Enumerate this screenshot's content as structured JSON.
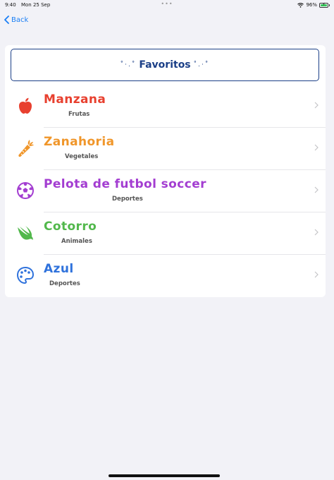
{
  "status_bar": {
    "time": "9:40",
    "date": "Mon 25 Sep",
    "battery": "96%"
  },
  "nav": {
    "back_label": "Back"
  },
  "header": {
    "title": "Favoritos",
    "decor_left": "˚·.˚",
    "decor_right": "˚.·˚"
  },
  "items": [
    {
      "title": "Manzana",
      "subtitle": "Frutas",
      "color": "#e8402f",
      "icon": "apple-icon"
    },
    {
      "title": "Zanahoria",
      "subtitle": "Vegetales",
      "color": "#f0962a",
      "icon": "carrot-icon"
    },
    {
      "title": "Pelota de futbol soccer",
      "subtitle": "Deportes",
      "color": "#a33dd1",
      "icon": "soccer-ball-icon"
    },
    {
      "title": "Cotorro",
      "subtitle": "Animales",
      "color": "#52b84c",
      "icon": "swift-bird-icon"
    },
    {
      "title": "Azul",
      "subtitle": "Deportes",
      "color": "#2f72dc",
      "icon": "palette-icon"
    }
  ]
}
